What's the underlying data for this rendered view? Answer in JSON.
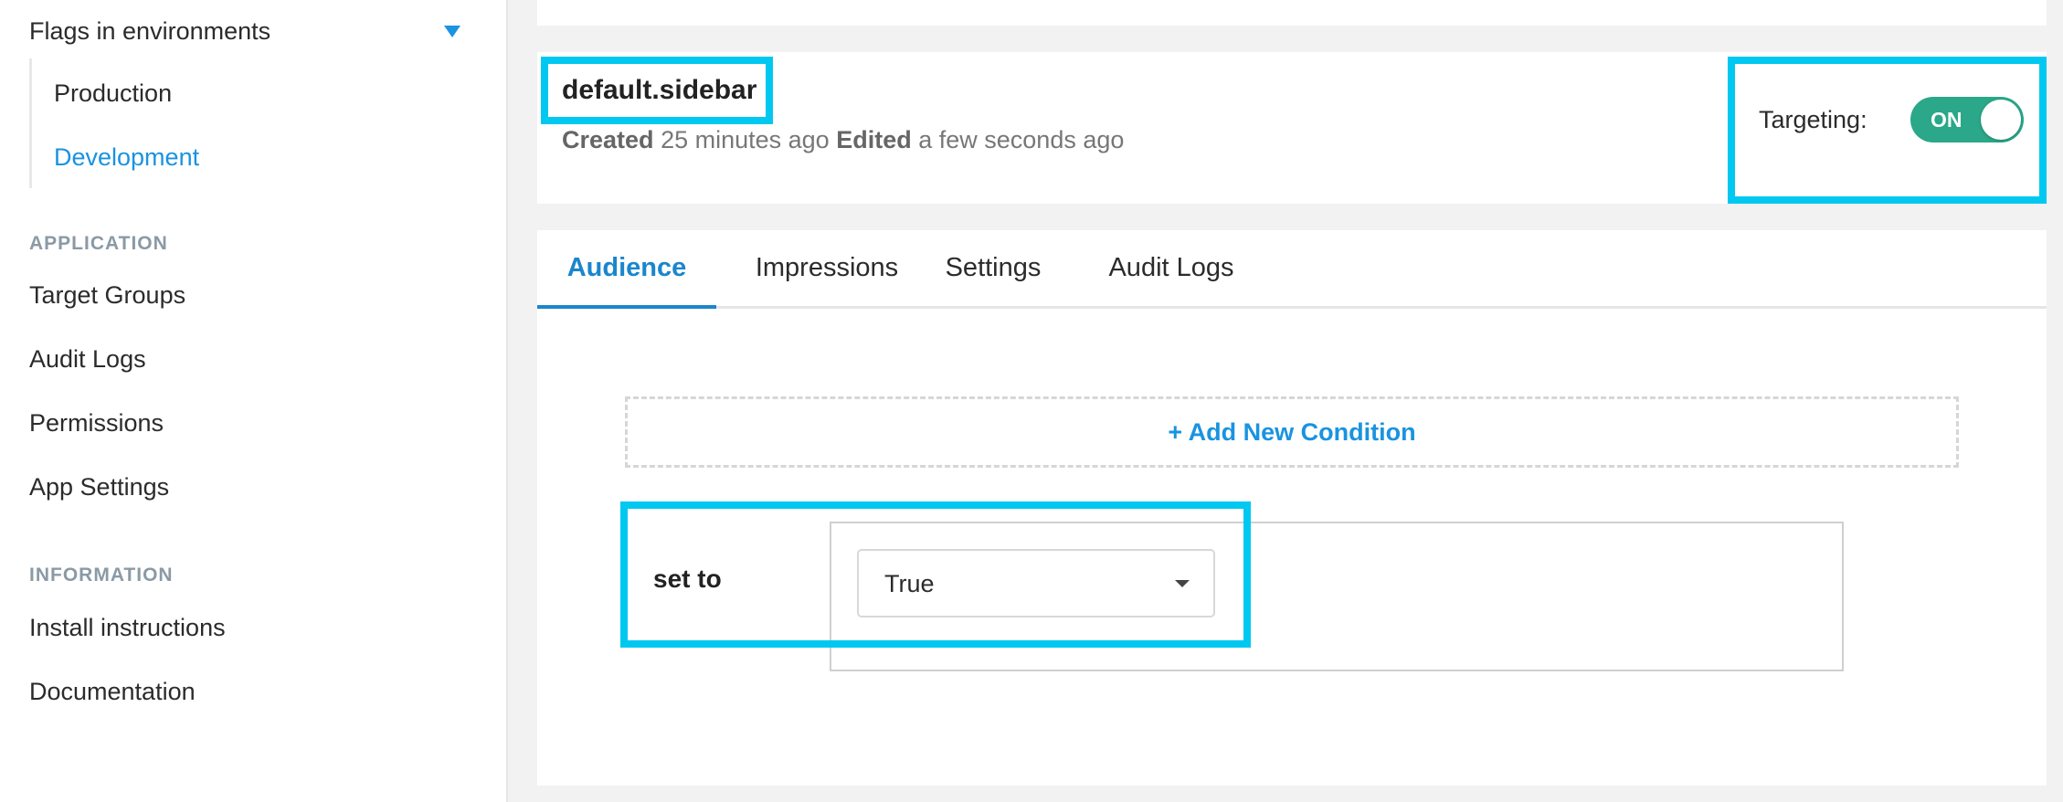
{
  "sidebar": {
    "env_header": "Flags in environments",
    "environments": [
      {
        "label": "Production",
        "active": false
      },
      {
        "label": "Development",
        "active": true
      }
    ],
    "application_label": "APPLICATION",
    "application_items": [
      "Target Groups",
      "Audit Logs",
      "Permissions",
      "App Settings"
    ],
    "information_label": "INFORMATION",
    "information_items": [
      "Install instructions",
      "Documentation"
    ]
  },
  "flag": {
    "name": "default.sidebar",
    "created_label": "Created",
    "created_value": "25 minutes ago",
    "edited_label": "Edited",
    "edited_value": "a few seconds ago",
    "targeting_label": "Targeting:",
    "targeting_state": "ON"
  },
  "tabs": [
    "Audience",
    "Impressions",
    "Settings",
    "Audit Logs"
  ],
  "audience": {
    "add_condition": "+ Add New Condition",
    "set_to_label": "set to",
    "set_to_value": "True"
  },
  "colors": {
    "accent": "#1a93e0",
    "highlight": "#00c8f0",
    "toggle_on": "#2aa889"
  }
}
